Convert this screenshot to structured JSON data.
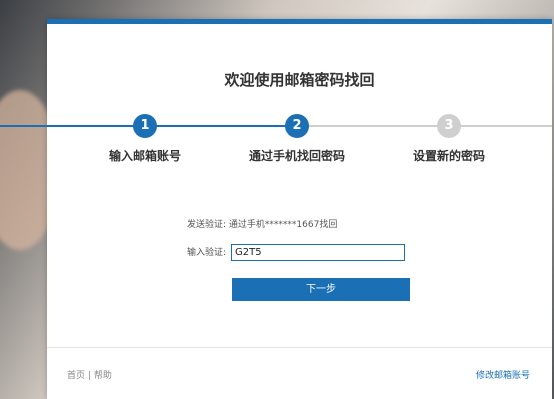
{
  "title": "欢迎使用邮箱密码找回",
  "steps": [
    {
      "number": "1",
      "label": "输入邮箱账号"
    },
    {
      "number": "2",
      "label": "通过手机找回密码"
    },
    {
      "number": "3",
      "label": "设置新的密码"
    }
  ],
  "current_step": 2,
  "verify": {
    "label": "发送验证:",
    "value": "通过手机*******1667找回"
  },
  "input": {
    "label": "输入验证:",
    "value": "G2T5"
  },
  "next_button": "下一步",
  "footer": {
    "home": "首页",
    "separator": "|",
    "help": "帮助",
    "modify_email": "修改邮箱账号"
  },
  "colors": {
    "accent": "#1a6fb5",
    "inactive": "#cfcfcf"
  }
}
